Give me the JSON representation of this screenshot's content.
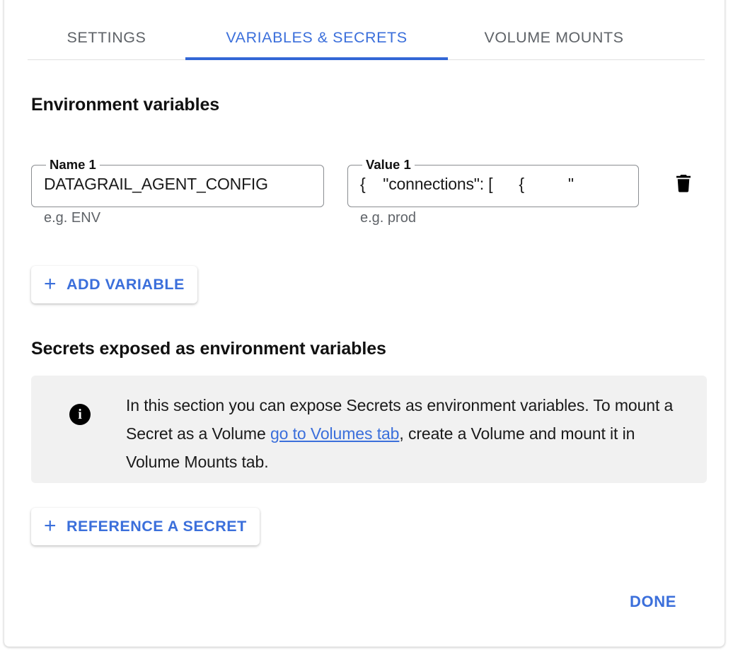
{
  "tabs": [
    {
      "label": "SETTINGS",
      "active": false
    },
    {
      "label": "VARIABLES & SECRETS",
      "active": true
    },
    {
      "label": "VOLUME MOUNTS",
      "active": false
    }
  ],
  "environment": {
    "heading": "Environment variables",
    "rows": [
      {
        "name_label": "Name 1",
        "name_value": "DATAGRAIL_AGENT_CONFIG",
        "name_helper": "e.g. ENV",
        "name_placeholder": "",
        "value_label": "Value 1",
        "value_value": "{    \"connections\": [      {          \"",
        "value_helper": "e.g. prod",
        "value_placeholder": "",
        "delete_icon": "trash-icon"
      }
    ],
    "add_variable_label": "ADD VARIABLE",
    "add_icon": "plus-icon"
  },
  "secrets": {
    "heading": "Secrets exposed as environment variables",
    "info_icon": "info-icon",
    "info_text_before": "In this section you can expose Secrets as environment variables. To mount a Secret as a Volume ",
    "info_link": "go to Volumes tab",
    "info_text_after": ", create a Volume and mount it in Volume Mounts tab.",
    "reference_secret_label": "REFERENCE A SECRET",
    "reference_icon": "plus-icon"
  },
  "footer": {
    "done_label": "DONE"
  },
  "colors": {
    "accent": "#3B6FDB",
    "tab_underline": "#3367D6",
    "inactive_tab": "#5f6368",
    "info_background": "#F1F1F1",
    "field_border": "#8a8d91"
  }
}
